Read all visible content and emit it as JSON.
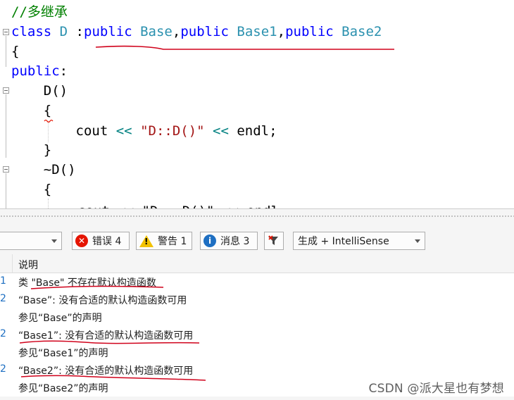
{
  "editor": {
    "lines": [
      {
        "tokens": [
          {
            "t": "//多继承",
            "c": "comment"
          }
        ]
      },
      {
        "tokens": [
          {
            "t": "class",
            "c": "keyword"
          },
          {
            "t": " ",
            "c": "plain"
          },
          {
            "t": "D",
            "c": "type"
          },
          {
            "t": " :",
            "c": "plain"
          },
          {
            "t": "public",
            "c": "keyword"
          },
          {
            "t": " ",
            "c": "plain"
          },
          {
            "t": "Base",
            "c": "type"
          },
          {
            "t": ",",
            "c": "plain"
          },
          {
            "t": "public",
            "c": "keyword"
          },
          {
            "t": " ",
            "c": "plain"
          },
          {
            "t": "Base1",
            "c": "type"
          },
          {
            "t": ",",
            "c": "plain"
          },
          {
            "t": "public",
            "c": "keyword"
          },
          {
            "t": " ",
            "c": "plain"
          },
          {
            "t": "Base2",
            "c": "type"
          }
        ]
      },
      {
        "tokens": [
          {
            "t": "{",
            "c": "plain"
          }
        ]
      },
      {
        "tokens": [
          {
            "t": "public",
            "c": "keyword"
          },
          {
            "t": ":",
            "c": "plain"
          }
        ]
      },
      {
        "tokens": [
          {
            "t": "    D()",
            "c": "plain"
          }
        ]
      },
      {
        "tokens": [
          {
            "t": "    {",
            "c": "plain"
          }
        ]
      },
      {
        "tokens": [
          {
            "t": "        cout ",
            "c": "plain"
          },
          {
            "t": "<<",
            "c": "op"
          },
          {
            "t": " ",
            "c": "plain"
          },
          {
            "t": "\"D::D()\"",
            "c": "string"
          },
          {
            "t": " ",
            "c": "plain"
          },
          {
            "t": "<<",
            "c": "op"
          },
          {
            "t": " endl;",
            "c": "plain"
          }
        ]
      },
      {
        "tokens": [
          {
            "t": "    }",
            "c": "plain"
          }
        ]
      },
      {
        "tokens": [
          {
            "t": "    ~D()",
            "c": "plain"
          }
        ]
      },
      {
        "tokens": [
          {
            "t": "    {",
            "c": "plain"
          }
        ]
      }
    ],
    "cut_line": "cout << \"D::~D()\" << endl;"
  },
  "toolbar": {
    "scope_value": "",
    "errors_label": "错误 4",
    "warnings_label": "警告 1",
    "messages_label": "消息 3",
    "info_glyph": "i",
    "warn_glyph": "!",
    "error_glyph": "✕",
    "build_filter": "生成 + IntelliSense"
  },
  "list": {
    "description_header": "说明",
    "rows": [
      {
        "code": "1",
        "text": "类 \"Base\" 不存在默认构造函数"
      },
      {
        "code": "2",
        "text": "“Base”: 没有合适的默认构造函数可用"
      },
      {
        "code": "",
        "text": "参见“Base”的声明"
      },
      {
        "code": "2",
        "text": "“Base1”: 没有合适的默认构造函数可用"
      },
      {
        "code": "",
        "text": "参见“Base1”的声明"
      },
      {
        "code": "2",
        "text": "“Base2”: 没有合适的默认构造函数可用"
      },
      {
        "code": "",
        "text": "参见“Base2”的声明"
      }
    ]
  },
  "watermark": "CSDN @派大星也有梦想",
  "colors": {
    "comment": "#008000",
    "keyword": "#0000ff",
    "type": "#2b91af",
    "string": "#a31515",
    "annotation_ink": "#d0021b"
  }
}
